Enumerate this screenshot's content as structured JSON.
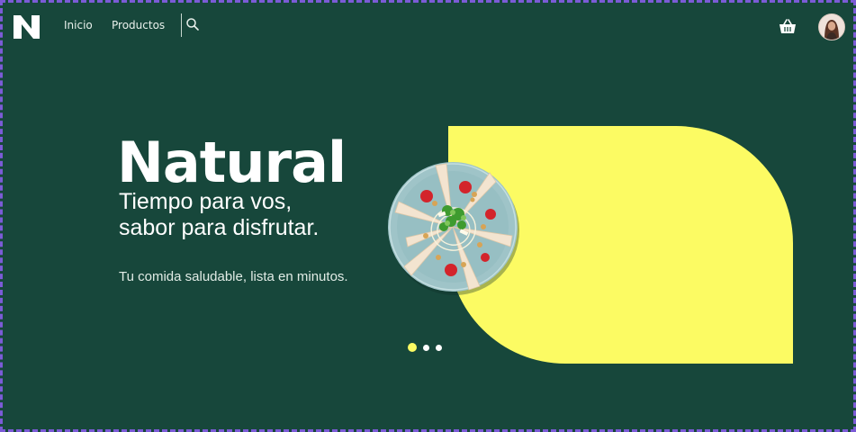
{
  "brand": {
    "logo_icon": "brand-n-logo-icon",
    "logo_letter": "N"
  },
  "nav": {
    "items": [
      {
        "label": "Inicio"
      },
      {
        "label": "Productos"
      }
    ],
    "search_icon": "search-icon"
  },
  "header_actions": {
    "basket_icon": "basket-icon",
    "avatar": "user-avatar"
  },
  "hero": {
    "title": "Natural",
    "subtitle_line1": "Tiempo para vos,",
    "subtitle_line2": "sabor para disfrutar.",
    "tagline": "Tu comida saludable, lista en minutos.",
    "image": "salad-plate-image"
  },
  "carousel": {
    "slide_count": 3,
    "active_index": 0
  },
  "colors": {
    "background": "#17473b",
    "accent_yellow": "#fcfb63",
    "text": "#ffffff",
    "frame_border": "#7b5bd6"
  }
}
